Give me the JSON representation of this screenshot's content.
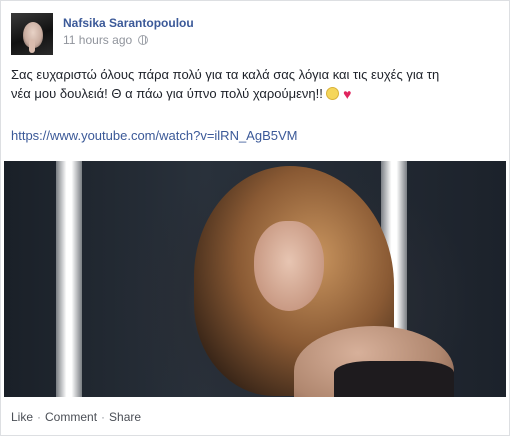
{
  "post": {
    "author": "Nafsika Sarantopoulou",
    "timestamp": "11 hours ago",
    "privacy_icon": "globe-icon",
    "message_line1": "Σας ευχαριστώ όλους πάρα πολύ για τα καλά σας λόγια και τις ευχές για τη",
    "message_line2": "νέα μου δουλειά! Θ α πάω για ύπνο πολύ χαρούμενη!! ",
    "link": "https://www.youtube.com/watch?v=ilRN_AgB5VM"
  },
  "actions": {
    "like": "Like",
    "comment": "Comment",
    "share": "Share",
    "separator": "·"
  }
}
